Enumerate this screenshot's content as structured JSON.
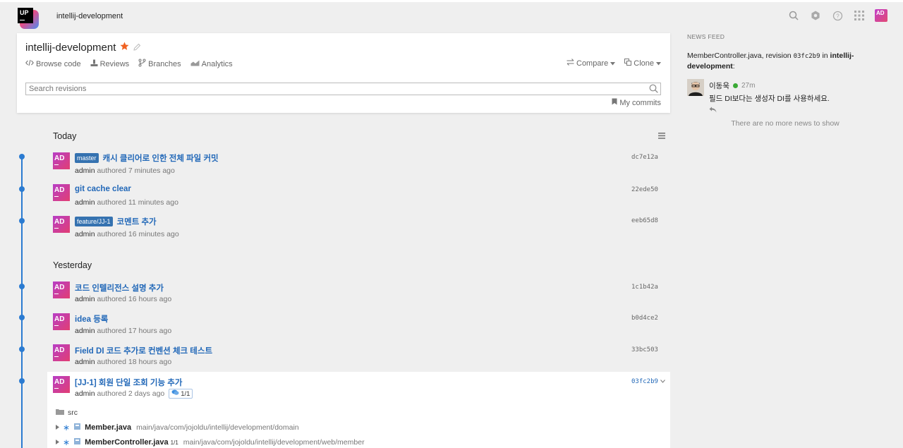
{
  "app": {
    "name": "intellij-development",
    "logo_text": "UP",
    "user_initials": "AD"
  },
  "colors": {
    "accent": "#2268b8",
    "timeline": "#2b7bd1",
    "branch_badge": "#3572b0",
    "star": "#f06222",
    "online": "#3aaa35"
  },
  "top_icons": [
    "search-icon",
    "settings-icon",
    "help-icon",
    "apps-grid-icon"
  ],
  "repo": {
    "title": "intellij-development",
    "tabs": [
      {
        "label": "Browse code",
        "icon": "code-icon"
      },
      {
        "label": "Reviews",
        "icon": "reviews-icon"
      },
      {
        "label": "Branches",
        "icon": "branches-icon"
      },
      {
        "label": "Analytics",
        "icon": "analytics-icon"
      }
    ],
    "actions": {
      "compare": "Compare",
      "clone": "Clone"
    },
    "search_placeholder": "Search revisions",
    "my_commits": "My commits"
  },
  "groups": [
    {
      "heading": "Today",
      "commits": [
        {
          "initials": "AD",
          "branch": "master",
          "title": "캐시 클리어로 인한 전체 파일 커밋",
          "author": "admin",
          "when": "authored 7 minutes ago",
          "hash": "dc7e12a"
        },
        {
          "initials": "AD",
          "branch": "",
          "title": "git cache clear",
          "author": "admin",
          "when": "authored 11 minutes ago",
          "hash": "22ede50"
        },
        {
          "initials": "AD",
          "branch": "feature/JJ-1",
          "title": "코멘트 추가",
          "author": "admin",
          "when": "authored 16 minutes ago",
          "hash": "eeb65d8"
        }
      ]
    },
    {
      "heading": "Yesterday",
      "commits": [
        {
          "initials": "AD",
          "branch": "",
          "title": "코드 인텔리전스 설명 추가",
          "author": "admin",
          "when": "authored 16 hours ago",
          "hash": "1c1b42a"
        },
        {
          "initials": "AD",
          "branch": "",
          "title": "idea 등록",
          "author": "admin",
          "when": "authored 17 hours ago",
          "hash": "b0d4ce2"
        },
        {
          "initials": "AD",
          "branch": "",
          "title": "Field DI 코드 추가로 컨벤션 체크 테스트",
          "author": "admin",
          "when": "authored 18 hours ago",
          "hash": "33bc503"
        }
      ]
    }
  ],
  "expanded_commit": {
    "initials": "AD",
    "title": "[JJ-1] 회원 단일 조회 기능 추가",
    "author": "admin",
    "when": "authored 2 days ago",
    "comments": "1/1",
    "hash": "03fc2b9",
    "folder": "src",
    "files": [
      {
        "name": "Member.java",
        "badge": "",
        "path": "main/java/com/jojoldu/intellij/development/domain"
      },
      {
        "name": "MemberController.java",
        "badge": "1/1",
        "path": "main/java/com/jojoldu/intellij/development/web/member"
      }
    ]
  },
  "news": {
    "title": "NEWS FEED",
    "event_prefix": "MemberController.java, revision",
    "event_revision": "03fc2b9",
    "event_mid": "in",
    "event_repo": "intellij-development",
    "event_suffix": ":",
    "user": "이동욱",
    "time": "27m",
    "comment": "필드 DI보다는 생성자 DI를 사용하세요.",
    "no_more": "There are no more news to show"
  }
}
